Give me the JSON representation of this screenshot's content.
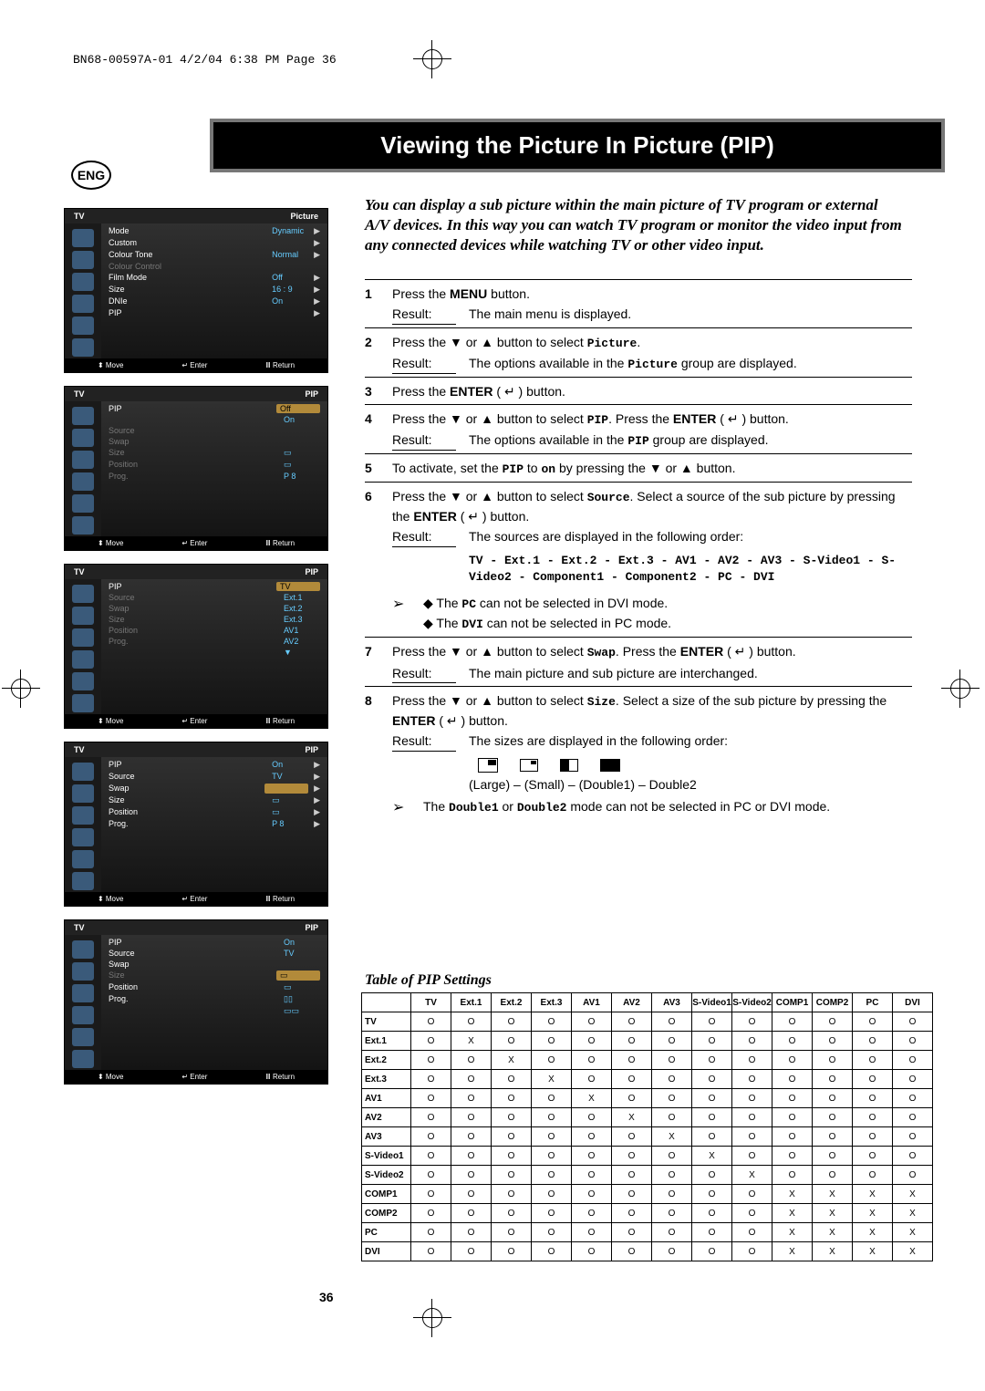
{
  "print_header": "BN68-00597A-01  4/2/04  6:38 PM  Page 36",
  "lang_badge": "ENG",
  "title": "Viewing the Picture In Picture (PIP)",
  "intro": "You can display a sub picture within the main picture of TV program or external A/V devices. In this way you can watch TV program or monitor the video input from any connected devices while watching TV or other video input.",
  "result_label": "Result:",
  "enter_glyph": "↵",
  "steps": {
    "s1": {
      "num": "1",
      "text_a": "Press the ",
      "text_b": "MENU",
      "text_c": " button.",
      "result": "The main menu is displayed."
    },
    "s2": {
      "num": "2",
      "text_a": "Press the ▼ or ▲ button to select ",
      "code": "Picture",
      "text_b": ".",
      "result_a": "The options available in the ",
      "result_code": "Picture",
      "result_b": " group are displayed."
    },
    "s3": {
      "num": "3",
      "text_a": "Press the ",
      "text_b": "ENTER",
      "text_c": " ( ",
      "text_d": " ) button."
    },
    "s4": {
      "num": "4",
      "text_a": "Press the ▼ or ▲ button to select ",
      "code": "PIP",
      "text_b": ". Press the ",
      "text_c": "ENTER",
      "text_d": " ( ",
      "text_e": " ) button.",
      "result_a": "The options available in the ",
      "result_code": "PIP",
      "result_b": " group are displayed."
    },
    "s5": {
      "num": "5",
      "text_a": "To activate, set the ",
      "code_a": "PIP",
      "text_b": " to ",
      "code_b": "on",
      "text_c": " by pressing the ▼ or ▲ button."
    },
    "s6": {
      "num": "6",
      "text_a": "Press the ▼ or ▲ button to select ",
      "code": "Source",
      "text_b": ". Select a source of the sub picture by pressing the ",
      "text_c": "ENTER",
      "text_d": " ( ",
      "text_e": " ) button.",
      "result": "The sources are displayed in the following order:",
      "sources": "TV - Ext.1 - Ext.2 - Ext.3 - AV1 - AV2 - AV3 - S-Video1 - S-Video2 - Component1 - Component2 - PC - DVI",
      "note1_a": "◆ The ",
      "note1_code": "PC",
      "note1_b": " can not be selected in DVI mode.",
      "note2_a": "◆ The ",
      "note2_code": "DVI",
      "note2_b": " can not be selected in PC mode."
    },
    "s7": {
      "num": "7",
      "text_a": "Press the ▼ or ▲ button to select ",
      "code": "Swap",
      "text_b": ". Press the ",
      "text_c": "ENTER",
      "text_d": " ( ",
      "text_e": " ) button.",
      "result": "The main picture and sub picture are interchanged."
    },
    "s8": {
      "num": "8",
      "text_a": "Press the ▼ or ▲ button to select ",
      "code": "Size",
      "text_b": ". Select a size of the sub picture by pressing the ",
      "text_c": "ENTER",
      "text_d": " ( ",
      "text_e": " ) button.",
      "result": "The sizes are displayed in the following order:",
      "sizes": "(Large) – (Small) – (Double1) – Double2",
      "note_a": "The ",
      "note_code_a": "Double1",
      "note_mid": " or ",
      "note_code_b": "Double2",
      "note_b": " mode can not be selected in PC or DVI mode."
    }
  },
  "osd_footer": {
    "move": "Move",
    "enter": "Enter",
    "return": "Return",
    "move_glyph": "⬍",
    "enter_glyph": "↵",
    "return_glyph": "Ⅲ"
  },
  "osd1": {
    "left": "TV",
    "right": "Picture",
    "rows": [
      {
        "label": "Mode",
        "val": "Dynamic",
        "caret": "▶"
      },
      {
        "label": "Custom",
        "val": "",
        "caret": "▶"
      },
      {
        "label": "Colour Tone",
        "val": "Normal",
        "caret": "▶"
      },
      {
        "label": "Colour Control",
        "val": "",
        "caret": "",
        "dim": true
      },
      {
        "label": "Film Mode",
        "val": "Off",
        "caret": "▶"
      },
      {
        "label": "Size",
        "val": "16 : 9",
        "caret": "▶"
      },
      {
        "label": "DNIe",
        "val": "On",
        "caret": "▶"
      },
      {
        "label": "PIP",
        "val": "",
        "caret": "▶"
      }
    ]
  },
  "osd2": {
    "left": "TV",
    "right": "PIP",
    "rows": [
      {
        "label": "PIP",
        "val": "Off",
        "sel": true
      },
      {
        "label": "",
        "val": "On",
        "dropdown": true
      },
      {
        "label": "Source",
        "val": "",
        "dim": true
      },
      {
        "label": "Swap",
        "val": "",
        "dim": true
      },
      {
        "label": "Size",
        "val": "▭",
        "dim": true
      },
      {
        "label": "Position",
        "val": "▭",
        "dim": true
      },
      {
        "label": "Prog.",
        "val": "P 8",
        "dim": true
      }
    ]
  },
  "osd3": {
    "left": "TV",
    "right": "PIP",
    "rows": [
      {
        "label": "PIP",
        "val": "TV",
        "sel": true
      },
      {
        "label": "Source",
        "val": "Ext.1",
        "dim": true
      },
      {
        "label": "Swap",
        "val": "Ext.2",
        "dim": true
      },
      {
        "label": "Size",
        "val": "Ext.3",
        "dim": true
      },
      {
        "label": "Position",
        "val": "AV1",
        "dim": true
      },
      {
        "label": "Prog.",
        "val": "AV2",
        "dim": true
      },
      {
        "label": "",
        "val": "▼",
        "dim": true
      }
    ]
  },
  "osd4": {
    "left": "TV",
    "right": "PIP",
    "rows": [
      {
        "label": "PIP",
        "val": "On",
        "caret": "▶"
      },
      {
        "label": "Source",
        "val": "TV",
        "caret": "▶"
      },
      {
        "label": "Swap",
        "val": "",
        "caret": "▶",
        "sel": true
      },
      {
        "label": "Size",
        "val": "▭",
        "caret": "▶"
      },
      {
        "label": "Position",
        "val": "▭",
        "caret": "▶"
      },
      {
        "label": "Prog.",
        "val": "P 8",
        "caret": "▶"
      }
    ]
  },
  "osd5": {
    "left": "TV",
    "right": "PIP",
    "rows": [
      {
        "label": "PIP",
        "val": "On"
      },
      {
        "label": "Source",
        "val": "TV"
      },
      {
        "label": "Swap",
        "val": ""
      },
      {
        "label": "Size",
        "val": "▭",
        "dim": true,
        "sel": true
      },
      {
        "label": "Position",
        "val": "▭"
      },
      {
        "label": "Prog.",
        "val": "▯▯"
      },
      {
        "label": "",
        "val": "▭▭"
      }
    ]
  },
  "table_title": "Table of PIP Settings",
  "table": {
    "cols": [
      "",
      "TV",
      "Ext.1",
      "Ext.2",
      "Ext.3",
      "AV1",
      "AV2",
      "AV3",
      "S-Video1",
      "S-Video2",
      "COMP1",
      "COMP2",
      "PC",
      "DVI"
    ],
    "rows": [
      {
        "h": "TV",
        "c": [
          "O",
          "O",
          "O",
          "O",
          "O",
          "O",
          "O",
          "O",
          "O",
          "O",
          "O",
          "O",
          "O"
        ]
      },
      {
        "h": "Ext.1",
        "c": [
          "O",
          "X",
          "O",
          "O",
          "O",
          "O",
          "O",
          "O",
          "O",
          "O",
          "O",
          "O",
          "O"
        ]
      },
      {
        "h": "Ext.2",
        "c": [
          "O",
          "O",
          "X",
          "O",
          "O",
          "O",
          "O",
          "O",
          "O",
          "O",
          "O",
          "O",
          "O"
        ]
      },
      {
        "h": "Ext.3",
        "c": [
          "O",
          "O",
          "O",
          "X",
          "O",
          "O",
          "O",
          "O",
          "O",
          "O",
          "O",
          "O",
          "O"
        ]
      },
      {
        "h": "AV1",
        "c": [
          "O",
          "O",
          "O",
          "O",
          "X",
          "O",
          "O",
          "O",
          "O",
          "O",
          "O",
          "O",
          "O"
        ]
      },
      {
        "h": "AV2",
        "c": [
          "O",
          "O",
          "O",
          "O",
          "O",
          "X",
          "O",
          "O",
          "O",
          "O",
          "O",
          "O",
          "O"
        ]
      },
      {
        "h": "AV3",
        "c": [
          "O",
          "O",
          "O",
          "O",
          "O",
          "O",
          "X",
          "O",
          "O",
          "O",
          "O",
          "O",
          "O"
        ]
      },
      {
        "h": "S-Video1",
        "c": [
          "O",
          "O",
          "O",
          "O",
          "O",
          "O",
          "O",
          "X",
          "O",
          "O",
          "O",
          "O",
          "O"
        ]
      },
      {
        "h": "S-Video2",
        "c": [
          "O",
          "O",
          "O",
          "O",
          "O",
          "O",
          "O",
          "O",
          "X",
          "O",
          "O",
          "O",
          "O"
        ]
      },
      {
        "h": "COMP1",
        "c": [
          "O",
          "O",
          "O",
          "O",
          "O",
          "O",
          "O",
          "O",
          "O",
          "X",
          "X",
          "X",
          "X"
        ]
      },
      {
        "h": "COMP2",
        "c": [
          "O",
          "O",
          "O",
          "O",
          "O",
          "O",
          "O",
          "O",
          "O",
          "X",
          "X",
          "X",
          "X"
        ]
      },
      {
        "h": "PC",
        "c": [
          "O",
          "O",
          "O",
          "O",
          "O",
          "O",
          "O",
          "O",
          "O",
          "X",
          "X",
          "X",
          "X"
        ]
      },
      {
        "h": "DVI",
        "c": [
          "O",
          "O",
          "O",
          "O",
          "O",
          "O",
          "O",
          "O",
          "O",
          "X",
          "X",
          "X",
          "X"
        ]
      }
    ]
  },
  "page_number": "36"
}
